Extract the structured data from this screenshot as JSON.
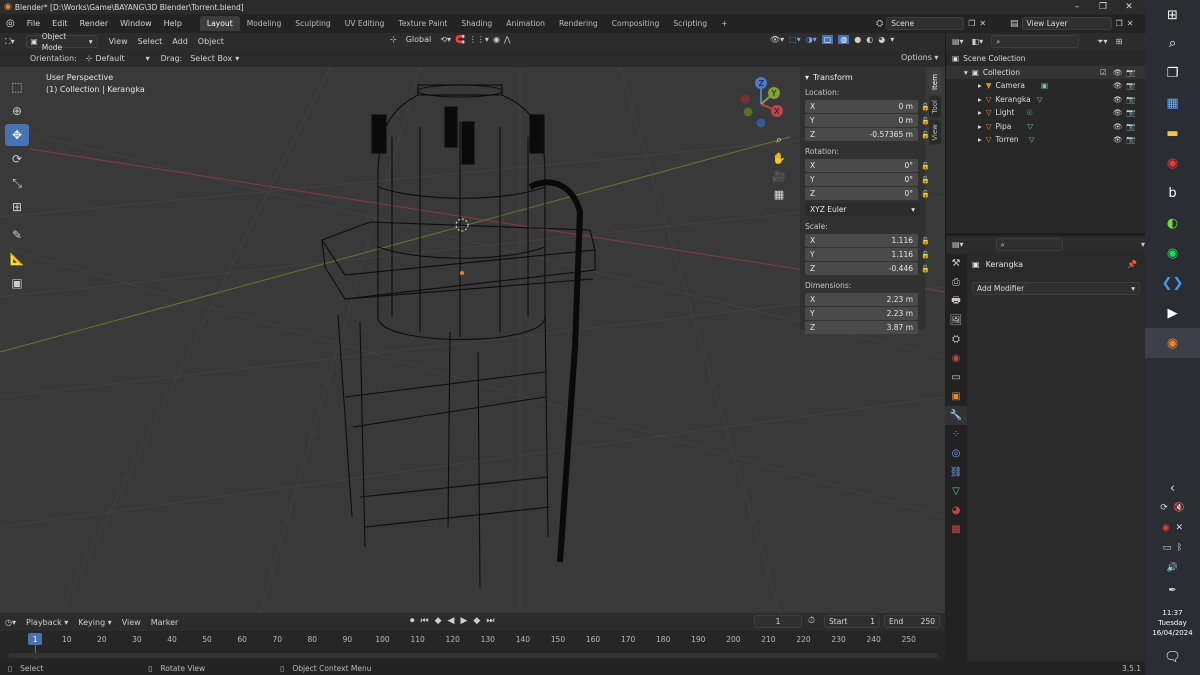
{
  "title_bar": {
    "text": "Blender* [D:\\Works\\Game\\BAYANG\\3D Blender\\Torrent.blend]"
  },
  "menu": {
    "items": [
      "File",
      "Edit",
      "Render",
      "Window",
      "Help"
    ]
  },
  "workspaces": [
    "Layout",
    "Modeling",
    "Sculpting",
    "UV Editing",
    "Texture Paint",
    "Shading",
    "Animation",
    "Rendering",
    "Compositing",
    "Scripting"
  ],
  "active_workspace": "Layout",
  "scene": {
    "name": "Scene",
    "view_layer": "View Layer"
  },
  "viewport_header": {
    "mode": "Object Mode",
    "menus": [
      "View",
      "Select",
      "Add",
      "Object"
    ],
    "transform_orientation": "Global"
  },
  "tool_options": {
    "orientation_label": "Orientation:",
    "orientation_value": "Default",
    "drag_label": "Drag:",
    "drag_value": "Select Box",
    "options_label": "Options"
  },
  "viewport": {
    "perspective": "User Perspective",
    "collection_info": "(1) Collection | Kerangka"
  },
  "npanel": {
    "tabs": [
      "Item",
      "Tool",
      "View"
    ],
    "section": "Transform",
    "location_label": "Location:",
    "location": [
      {
        "axis": "X",
        "value": "0 m"
      },
      {
        "axis": "Y",
        "value": "0 m"
      },
      {
        "axis": "Z",
        "value": "-0.57365 m"
      }
    ],
    "rotation_label": "Rotation:",
    "rotation": [
      {
        "axis": "X",
        "value": "0°"
      },
      {
        "axis": "Y",
        "value": "0°"
      },
      {
        "axis": "Z",
        "value": "0°"
      }
    ],
    "rotation_mode": "XYZ Euler",
    "scale_label": "Scale:",
    "scale": [
      {
        "axis": "X",
        "value": "1.116"
      },
      {
        "axis": "Y",
        "value": "1.116"
      },
      {
        "axis": "Z",
        "value": "-0.446"
      }
    ],
    "dimensions_label": "Dimensions:",
    "dimensions": [
      {
        "axis": "X",
        "value": "2.23 m"
      },
      {
        "axis": "Y",
        "value": "2.23 m"
      },
      {
        "axis": "Z",
        "value": "3.87 m"
      }
    ]
  },
  "gizmo": {
    "x": "X",
    "y": "Y",
    "z": "Z"
  },
  "timeline": {
    "menus": [
      "Playback",
      "Keying",
      "View",
      "Marker"
    ],
    "current_frame": "1",
    "start_label": "Start",
    "start": "1",
    "end_label": "End",
    "end": "250",
    "ticks": [
      "1",
      "10",
      "20",
      "30",
      "40",
      "50",
      "60",
      "70",
      "80",
      "90",
      "100",
      "110",
      "120",
      "130",
      "140",
      "150",
      "160",
      "170",
      "180",
      "190",
      "200",
      "210",
      "220",
      "230",
      "240",
      "250"
    ]
  },
  "status_bar": {
    "select": "Select",
    "rotate": "Rotate View",
    "context": "Object Context Menu",
    "version": "3.5.1"
  },
  "outliner": {
    "root": "Scene Collection",
    "collection": "Collection",
    "items": [
      "Camera",
      "Kerangka",
      "Light",
      "Pipa",
      "Torren"
    ]
  },
  "properties": {
    "object_name": "Kerangka",
    "add_modifier": "Add Modifier"
  },
  "taskbar": {
    "time": "11:37",
    "day": "Tuesday",
    "date": "16/04/2024"
  },
  "colors": {
    "accent": "#4772b3",
    "x_axis": "#c0454f",
    "y_axis": "#7fa13a",
    "z_axis": "#4a7bd1",
    "orange": "#e8872e"
  }
}
